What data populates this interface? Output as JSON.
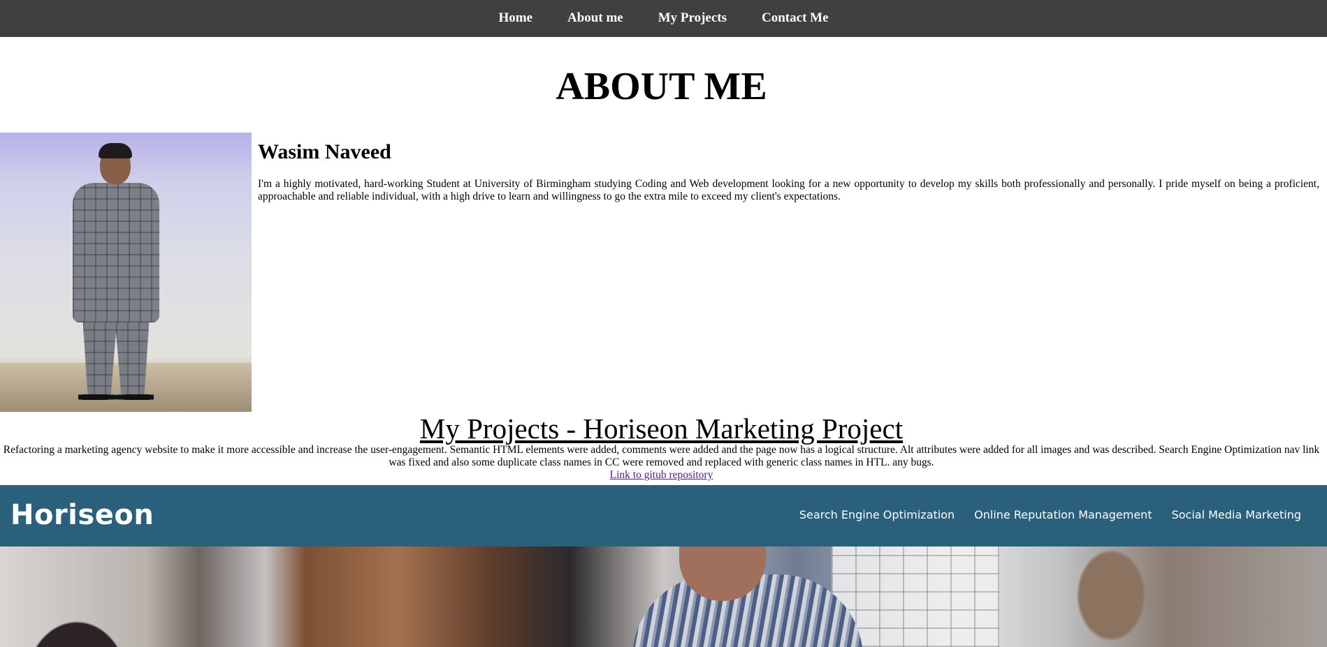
{
  "nav": {
    "items": [
      "Home",
      "About me",
      "My Projects",
      "Contact Me"
    ]
  },
  "about": {
    "title": "ABOUT ME",
    "name": "Wasim Naveed",
    "bio": "I'm a highly motivated, hard-working Student at University of Birmingham studying Coding and Web development looking for a new opportunity to develop my skills both professionally and personally. I pride myself on being a proficient, approachable and reliable individual, with a high drive to learn and willingness to go the extra mile to exceed my client's expectations."
  },
  "projects": {
    "title": "My Projects - Horiseon Marketing Project",
    "description": "Refactoring a marketing agency website to make it more accessible and increase the user-engagement. Semantic HTML elements were added, comments were added and the page now has a logical structure. Alt attributes were added for all images and was described. Search Engine Optimization nav link was fixed and also some duplicate class names in CC were removed and replaced with generic class names in HTL. any bugs.",
    "repo_link": "Link to gitub repository"
  },
  "horiseon": {
    "logo": "Horiseon",
    "nav": [
      "Search Engine Optimization",
      "Online Reputation Management",
      "Social Media Marketing"
    ]
  },
  "colors": {
    "nav_bg": "#404040",
    "horiseon_header": "#2a607c",
    "visited_link": "#551a8b"
  }
}
